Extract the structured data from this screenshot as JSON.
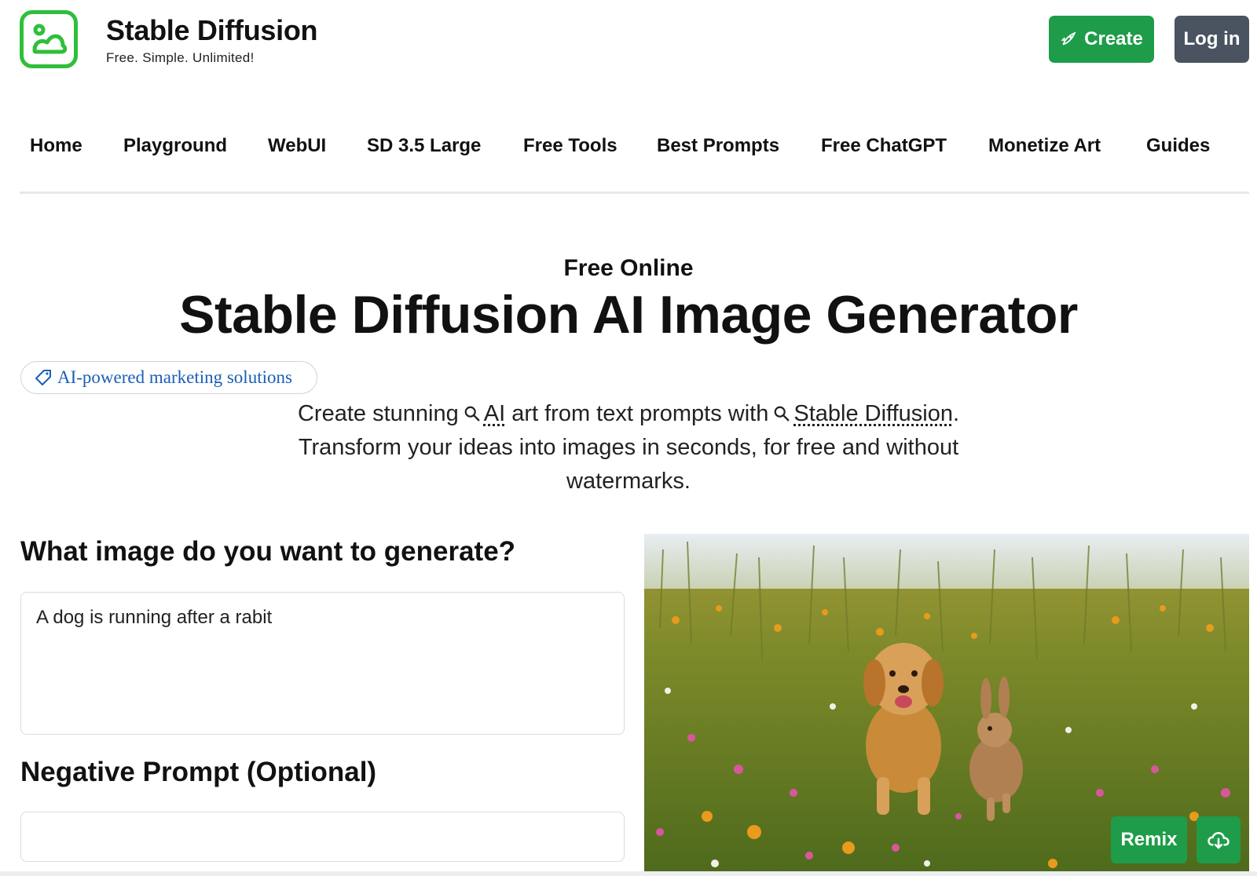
{
  "header": {
    "brand_title": "Stable Diffusion",
    "brand_tagline": "Free. Simple. Unlimited!",
    "create_label": "Create",
    "login_label": "Log in"
  },
  "nav": {
    "items": [
      "Home",
      "Playground",
      "WebUI",
      "SD 3.5 Large",
      "Free Tools",
      "Best Prompts",
      "Free ChatGPT",
      "Monetize Art",
      "Guides"
    ]
  },
  "hero": {
    "kicker": "Free Online",
    "title": "Stable Diffusion AI Image Generator",
    "ad_label": "AI-powered marketing solutions",
    "desc_part1": "Create stunning",
    "desc_link1": "AI",
    "desc_part2": "art from text prompts with",
    "desc_link2": "Stable Diffusion",
    "desc_part3": ".",
    "desc_line2": "Transform your ideas into images in seconds, for free and without watermarks."
  },
  "form": {
    "prompt_heading": "What image do you want to generate?",
    "prompt_value": "A dog is running after a rabit",
    "negative_heading": "Negative Prompt (Optional)",
    "negative_value": ""
  },
  "result": {
    "remix_label": "Remix",
    "download_icon": "cloud-download-icon"
  },
  "colors": {
    "brand_green": "#2fbf3a",
    "button_green": "#1e9c4a",
    "login_gray": "#4a5360",
    "ad_link_blue": "#1a5fb4"
  }
}
